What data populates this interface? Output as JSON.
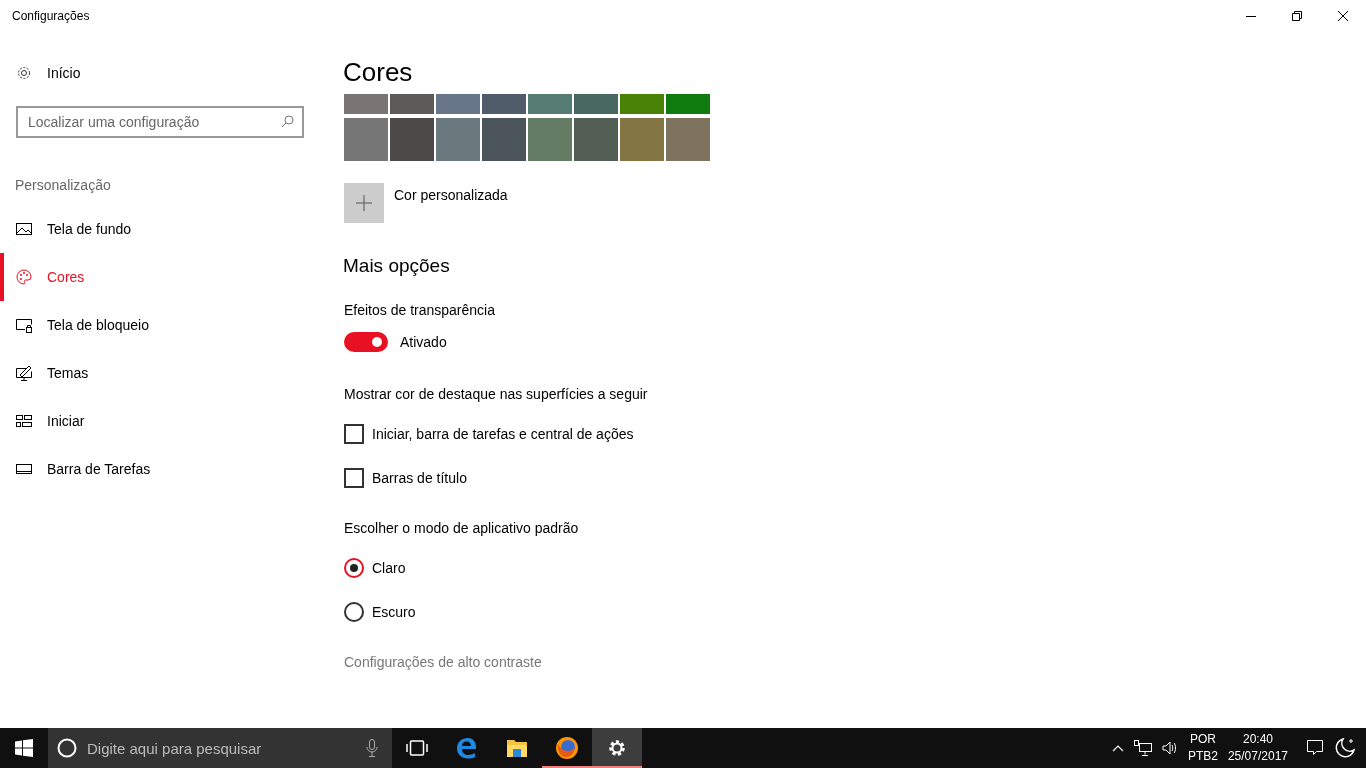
{
  "window": {
    "title": "Configurações"
  },
  "sidebar": {
    "home": "Início",
    "search": {
      "placeholder": "Localizar uma configuração"
    },
    "section": "Personalização",
    "items": [
      {
        "label": "Tela de fundo",
        "selected": false
      },
      {
        "label": "Cores",
        "selected": true
      },
      {
        "label": "Tela de bloqueio",
        "selected": false
      },
      {
        "label": "Temas",
        "selected": false
      },
      {
        "label": "Iniciar",
        "selected": false
      },
      {
        "label": "Barra de Tarefas",
        "selected": false
      }
    ]
  },
  "main": {
    "title": "Cores",
    "swatches_top": [
      {
        "color": "#7a7574"
      },
      {
        "color": "#5d5a58"
      },
      {
        "color": "#68768a"
      },
      {
        "color": "#515c6b"
      },
      {
        "color": "#567c73"
      },
      {
        "color": "#486860"
      },
      {
        "color": "#498205"
      },
      {
        "color": "#107c10"
      }
    ],
    "swatches_bottom": [
      {
        "color": "#767676"
      },
      {
        "color": "#4c4a48"
      },
      {
        "color": "#69797e"
      },
      {
        "color": "#4a5459"
      },
      {
        "color": "#647c64"
      },
      {
        "color": "#525e54"
      },
      {
        "color": "#847545"
      },
      {
        "color": "#7e735f"
      }
    ],
    "custom_color": "Cor personalizada",
    "more_heading": "Mais opções",
    "transparency": {
      "label": "Efeitos de transparência",
      "on": true,
      "state_text": "Ativado"
    },
    "accent_heading": "Mostrar cor de destaque nas superfícies a seguir",
    "checkboxes": [
      {
        "label": "Iniciar, barra de tarefas e central de ações",
        "checked": false
      },
      {
        "label": "Barras de título",
        "checked": false
      }
    ],
    "mode_heading": "Escolher o modo de aplicativo padrão",
    "modes": [
      {
        "label": "Claro",
        "selected": true
      },
      {
        "label": "Escuro",
        "selected": false
      }
    ],
    "high_contrast_link": "Configurações de alto contraste"
  },
  "taskbar": {
    "search": {
      "placeholder": "Digite aqui para pesquisar"
    },
    "apps": [
      {
        "running": false,
        "selected": false
      },
      {
        "running": false,
        "selected": false
      },
      {
        "running": false,
        "selected": false
      },
      {
        "running": true,
        "selected": false
      },
      {
        "running": true,
        "selected": true
      }
    ],
    "language": "POR",
    "layout": "PTB2",
    "time": "20:40",
    "date": "25/07/2017"
  }
}
